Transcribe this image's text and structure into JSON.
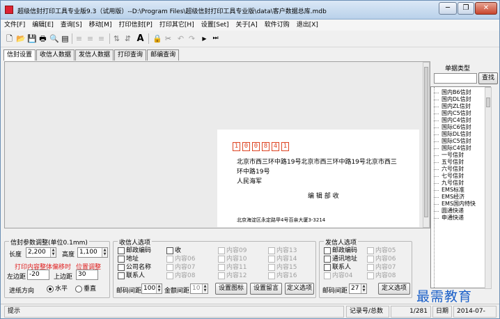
{
  "window": {
    "title": "超级信封打印工具专业版9.3（试用版）--D:\\Program Files\\超级信封打印工具专业版\\data\\客户数据总库.mdb",
    "minimize_glyph": "─",
    "restore_glyph": "❐",
    "close_glyph": "✕"
  },
  "menu": [
    "文件[F]",
    "编辑[E]",
    "查询[S]",
    "移动[M]",
    "打印信封[P]",
    "打印其它[H]",
    "设置[Set]",
    "关于[A]",
    "软件订购",
    "退出[X]"
  ],
  "toolbar": [
    {
      "icon": "new-file-icon",
      "glyph": "🗋"
    },
    {
      "icon": "open-folder-icon",
      "glyph": "📂"
    },
    {
      "icon": "save-icon",
      "glyph": "💾"
    },
    {
      "icon": "print-icon",
      "glyph": "🖶"
    },
    {
      "icon": "preview-icon",
      "glyph": "🔍"
    },
    {
      "icon": "green-page-icon",
      "glyph": "▤"
    },
    {
      "icon": "align-left-icon",
      "glyph": "≡"
    },
    {
      "icon": "align-center-icon",
      "glyph": "≡"
    },
    {
      "icon": "align-right-icon",
      "glyph": "≡"
    },
    {
      "icon": "sort-asc-icon",
      "glyph": "⇅"
    },
    {
      "icon": "sort-desc-icon",
      "glyph": "⇵"
    },
    {
      "icon": "font-icon",
      "glyph": "A"
    },
    {
      "icon": "lock-icon",
      "glyph": "🔒"
    },
    {
      "icon": "cut-icon",
      "glyph": "✂"
    },
    {
      "icon": "undo-icon",
      "glyph": "↶"
    },
    {
      "icon": "redo-icon",
      "glyph": "↷"
    },
    {
      "icon": "play-icon",
      "glyph": "▶"
    },
    {
      "icon": "next-end-icon",
      "glyph": "⏭"
    }
  ],
  "tabs": [
    "信封设置",
    "收信人数据",
    "发信人数据",
    "打印查询",
    "邮编查询"
  ],
  "envelope": {
    "zip_digits": [
      "1",
      "0",
      "0",
      "8",
      "4",
      "1"
    ],
    "address_line1": "北京市西三环中路19号北京市西三环中路19号北京市西三",
    "address_line2": "环中路19号",
    "name": "人民海军",
    "recipient": "编 辑 部   收",
    "sender": "北京海淀区永定路甲4号百亲大厦3-3214"
  },
  "right_panel": {
    "title": "单据类型",
    "search_value": "",
    "search_button": "查找",
    "tree_items": [
      "国内B6信封",
      "国内DL信封",
      "国内ZL信封",
      "国内C5信封",
      "国内C4信封",
      "国际C6信封",
      "国际DL信封",
      "国际C5信封",
      "国际C4信封",
      "一号信封",
      "五号信封",
      "六号信封",
      "七号信封",
      "九号信封",
      "EMS标准",
      "EMS经济",
      "EMS国内特快",
      "圆通快递",
      "申通快递"
    ]
  },
  "envelope_params": {
    "title": "信封参数调整(单位0.1mm)",
    "length_label": "长度",
    "length_value": "2,200",
    "height_label": "高度",
    "height_value": "1,100",
    "red_text_1": "打印内容整体偏移时",
    "red_text_2": "位置调整",
    "left_margin_label": "左边距",
    "left_margin_value": "-20",
    "top_margin_label": "上边距",
    "top_margin_value": "30",
    "direction_label": "进纸方向",
    "horizontal_label": "水平",
    "vertical_label": "垂直"
  },
  "recipient_options": {
    "title": "收信人选项",
    "col1": [
      "邮政编码",
      "地址",
      "公司名称",
      "联系人"
    ],
    "col2": [
      "收",
      "内容06",
      "内容07",
      "内容08"
    ],
    "col3": [
      "内容09",
      "内容10",
      "内容11",
      "内容12"
    ],
    "col4": [
      "内容13",
      "内容14",
      "内容15",
      "内容16"
    ],
    "zip_spacing_label": "邮码间距",
    "zip_spacing_value": "100",
    "amount_spacing_label": "金额间距",
    "amount_spacing_value": "10",
    "btn_icon": "设置图标",
    "btn_message": "设置留言",
    "btn_custom": "定义选项"
  },
  "sender_options": {
    "title": "发信人选项",
    "col1": [
      "邮政编码",
      "通讯地址",
      "联系人",
      "内容04"
    ],
    "col2": [
      "内容05",
      "内容06",
      "内容07",
      "内容08"
    ],
    "zip_spacing_label": "邮码间距",
    "zip_spacing_value": "27",
    "btn_custom": "定义选项"
  },
  "status": {
    "hint": "提示",
    "record_label": "记录号/总数",
    "record_value": "1/281",
    "date_label": "日期",
    "date_value": "2014-07-"
  },
  "watermark": "最需教育"
}
